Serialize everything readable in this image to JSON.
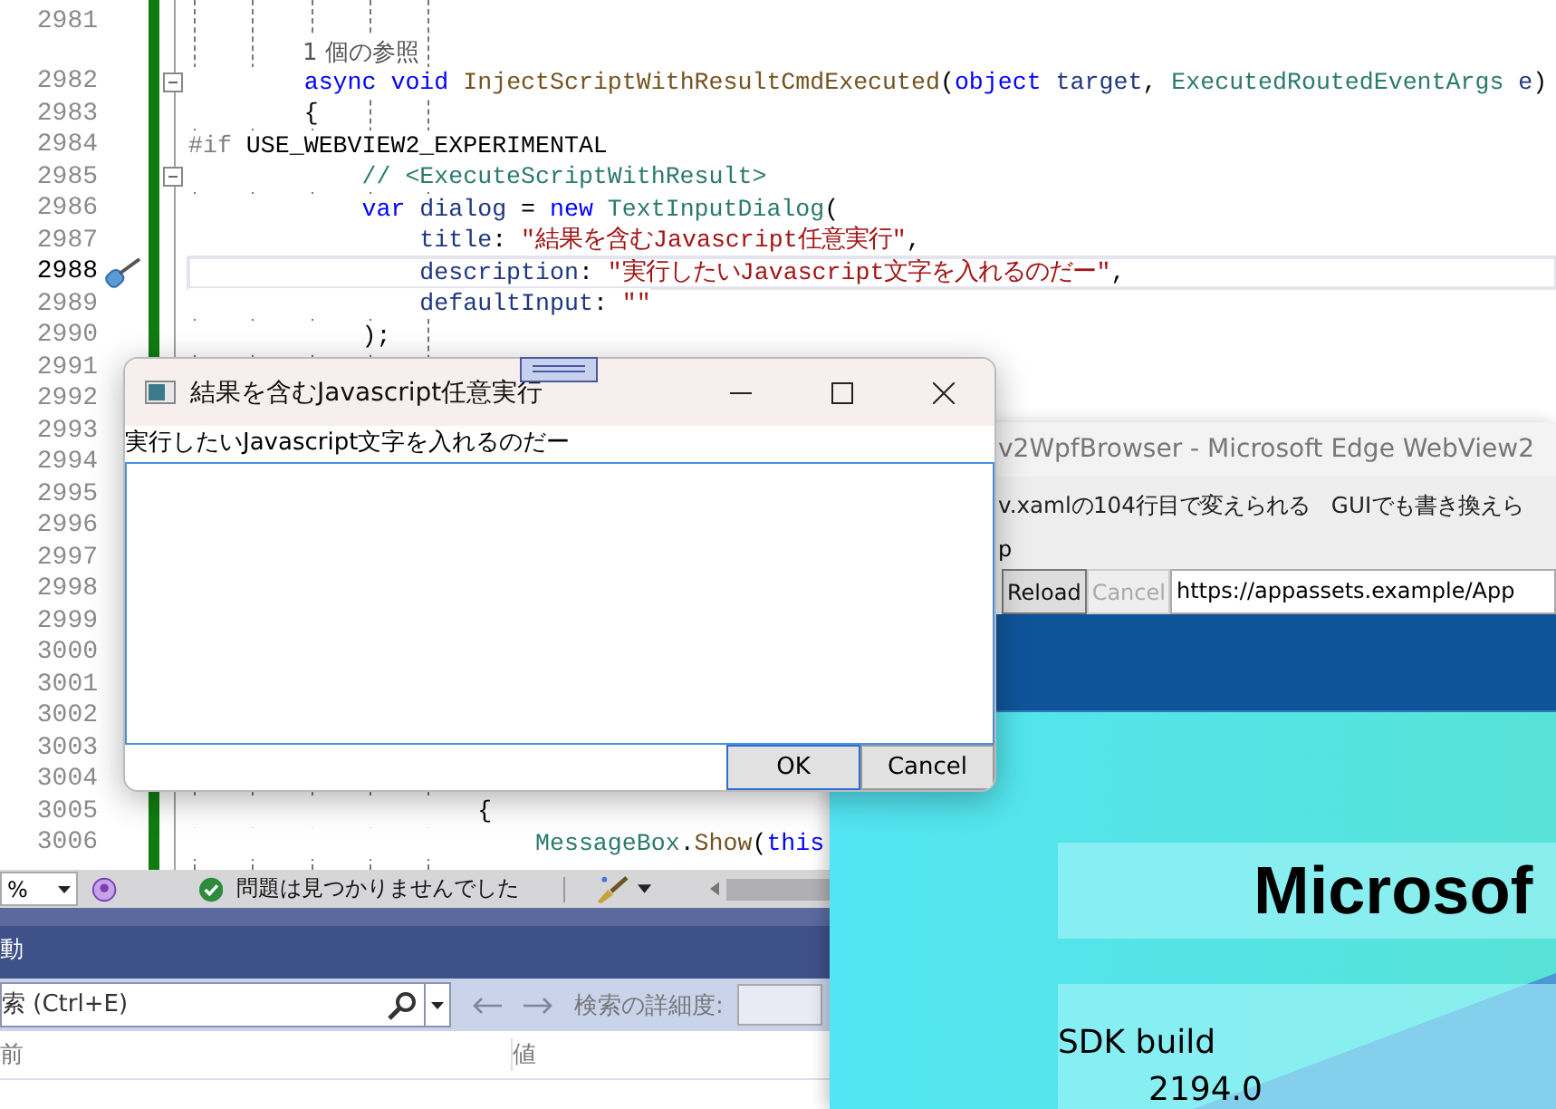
{
  "editor": {
    "lines": [
      {
        "kind": "code",
        "number": "2981",
        "current": false,
        "foldable": false
      },
      {
        "kind": "codelens",
        "text": "1 個の参照"
      },
      {
        "kind": "code",
        "number": "2982",
        "current": false,
        "foldable": true,
        "tokens": [
          {
            "kind": "keyword",
            "text": "        async "
          },
          {
            "kind": "keyword",
            "text": "void "
          },
          {
            "kind": "method",
            "text": "InjectScriptWithResultCmdExecuted"
          },
          {
            "kind": "plain",
            "text": "("
          },
          {
            "kind": "keyword",
            "text": "object "
          },
          {
            "kind": "param",
            "text": "target"
          },
          {
            "kind": "plain",
            "text": ", "
          },
          {
            "kind": "type",
            "text": "ExecutedRoutedEventArgs "
          },
          {
            "kind": "param",
            "text": "e"
          },
          {
            "kind": "plain",
            "text": ")"
          }
        ]
      },
      {
        "kind": "code",
        "number": "2983",
        "current": false,
        "foldable": false,
        "tokens": [
          {
            "kind": "plain",
            "text": "        {"
          }
        ]
      },
      {
        "kind": "code",
        "number": "2984",
        "current": false,
        "foldable": false,
        "tokens": [
          {
            "kind": "preproc",
            "text": "#if "
          },
          {
            "kind": "plain",
            "text": "USE_WEBVIEW2_EXPERIMENTAL"
          }
        ]
      },
      {
        "kind": "code",
        "number": "2985",
        "current": false,
        "foldable": true,
        "tokens": [
          {
            "kind": "comment",
            "text": "            // <ExecuteScriptWithResult>"
          }
        ]
      },
      {
        "kind": "code",
        "number": "2986",
        "current": false,
        "foldable": false,
        "tokens": [
          {
            "kind": "keyword",
            "text": "            var "
          },
          {
            "kind": "param",
            "text": "dialog "
          },
          {
            "kind": "plain",
            "text": "= "
          },
          {
            "kind": "keyword",
            "text": "new "
          },
          {
            "kind": "type",
            "text": "TextInputDialog"
          },
          {
            "kind": "plain",
            "text": "("
          }
        ]
      },
      {
        "kind": "code",
        "number": "2987",
        "current": false,
        "foldable": false,
        "tokens": [
          {
            "kind": "param",
            "text": "                title"
          },
          {
            "kind": "plain",
            "text": ": "
          },
          {
            "kind": "string",
            "text": "\"結果を含むJavascript任意実行\""
          },
          {
            "kind": "plain",
            "text": ","
          }
        ]
      },
      {
        "kind": "code",
        "number": "2988",
        "current": true,
        "foldable": false,
        "tokens": [
          {
            "kind": "param",
            "text": "                description"
          },
          {
            "kind": "plain",
            "text": ": "
          },
          {
            "kind": "string",
            "text": "\"実行したいJavascript文字を入れるのだー\""
          },
          {
            "kind": "plain",
            "text": ","
          }
        ]
      },
      {
        "kind": "code",
        "number": "2989",
        "current": false,
        "foldable": false,
        "tokens": [
          {
            "kind": "param",
            "text": "                defaultInput"
          },
          {
            "kind": "plain",
            "text": ": "
          },
          {
            "kind": "string",
            "text": "\"\""
          }
        ]
      },
      {
        "kind": "code",
        "number": "2990",
        "current": false,
        "foldable": false,
        "tokens": [
          {
            "kind": "plain",
            "text": "            );"
          }
        ]
      },
      {
        "kind": "code",
        "number": "2991",
        "current": false,
        "foldable": false
      },
      {
        "kind": "code",
        "number": "2992",
        "current": false,
        "foldable": false
      },
      {
        "kind": "code",
        "number": "2993",
        "current": false,
        "foldable": false
      },
      {
        "kind": "code",
        "number": "2994",
        "current": false,
        "foldable": false
      },
      {
        "kind": "code",
        "number": "2995",
        "current": false,
        "foldable": false
      },
      {
        "kind": "code",
        "number": "2996",
        "current": false,
        "foldable": false
      },
      {
        "kind": "code",
        "number": "2997",
        "current": false,
        "foldable": false
      },
      {
        "kind": "code",
        "number": "2998",
        "current": false,
        "foldable": false
      },
      {
        "kind": "code",
        "number": "2999",
        "current": false,
        "foldable": false
      },
      {
        "kind": "code",
        "number": "3000",
        "current": false,
        "foldable": false
      },
      {
        "kind": "code",
        "number": "3001",
        "current": false,
        "foldable": false
      },
      {
        "kind": "code",
        "number": "3002",
        "current": false,
        "foldable": false
      },
      {
        "kind": "code",
        "number": "3003",
        "current": false,
        "foldable": false
      },
      {
        "kind": "code",
        "number": "3004",
        "current": false,
        "foldable": false
      },
      {
        "kind": "code",
        "number": "3005",
        "current": false,
        "foldable": false,
        "tokens": [
          {
            "kind": "plain",
            "text": "                    {"
          }
        ]
      },
      {
        "kind": "code",
        "number": "3006",
        "current": false,
        "foldable": false,
        "tokens": [
          {
            "kind": "type",
            "text": "                        MessageBox"
          },
          {
            "kind": "plain",
            "text": "."
          },
          {
            "kind": "method",
            "text": "Show"
          },
          {
            "kind": "plain",
            "text": "("
          },
          {
            "kind": "keyword",
            "text": "this"
          }
        ]
      }
    ]
  },
  "status_bar": {
    "zoom": "%",
    "status": "問題は見つかりませんでした"
  },
  "panel": {
    "title": "動",
    "search": {
      "placeholder": "索 (Ctrl+E)"
    },
    "depth_label": "検索の詳細度:",
    "columns": [
      "前",
      "値"
    ]
  },
  "webview": {
    "title": "v2WpfBrowser - Microsoft Edge WebView2",
    "notice": "v.xamlの104行目で変えられる　GUIでも書き換えら",
    "fragment": "p",
    "buttons": [
      {
        "label": "Reload",
        "disabled": false
      },
      {
        "label": "Cancel",
        "disabled": true
      }
    ],
    "url": "https://appassets.example/App",
    "heading": "Microsof",
    "sdk_label": "SDK build",
    "sdk_value": "2194.0"
  },
  "dialog": {
    "title": "結果を含むJavascript任意実行",
    "description": "実行したいJavascript文字を入れるのだー",
    "buttons": [
      "OK",
      "Cancel"
    ]
  }
}
